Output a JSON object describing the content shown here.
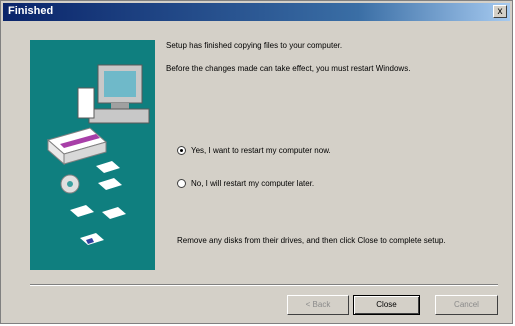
{
  "window": {
    "title": "Finished"
  },
  "title_bar": {
    "close_glyph": "x"
  },
  "content": {
    "line1": "Setup has finished copying files to your computer.",
    "line2": "Before the changes made can take effect, you must restart Windows.",
    "line3": "Remove any disks from their drives, and then click Close to complete setup."
  },
  "options": [
    {
      "label": "Yes, I want to restart my computer now.",
      "selected": true
    },
    {
      "label": "No, I will restart my computer later.",
      "selected": false
    }
  ],
  "buttons": {
    "back": "< Back",
    "close": "Close",
    "cancel": "Cancel"
  },
  "colors": {
    "art_background": "#0f7f7f",
    "dialog_face": "#d4d0c8",
    "title_bar_start": "#0a246a"
  },
  "illustration_icons": [
    "computer-icon",
    "disk-drive-icon",
    "cd-icon",
    "floppy-icon"
  ]
}
